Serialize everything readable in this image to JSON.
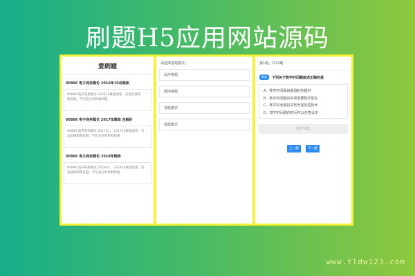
{
  "banner": {
    "title": "刷题H5应用网站源码"
  },
  "panel1": {
    "title": "爱刷题",
    "exams": [
      {
        "title": "00896 电子商务概论 2016年10月题库",
        "desc_lines": [
          "00896 电子商务概论 201610真题试卷，包含选择和",
          "简答题，不包含分析和材料题"
        ]
      },
      {
        "title": "00896 电子商务概论 2017年题库 含解析",
        "desc_lines": [
          "00896 电子商务概论 201704， 201710真题试卷，包",
          "含选择和简答题，不包含分析和材料题"
        ]
      },
      {
        "title": "00896 电子商务概论 2018年题库",
        "desc_lines": [
          "00896 电子商务概论 201804， 201810真题试卷，包",
          "含选择和简答题，不包含分析和材料题"
        ]
      }
    ]
  },
  "panel2": {
    "hint": "请选择答题模式：",
    "modes": [
      "乱序答题",
      "顺序答题",
      "背题模式",
      "错题模式"
    ]
  },
  "panel3": {
    "progress": "第1题，共30题",
    "badge": "单选",
    "question": "下列关于数字时间戳叙述正确的是",
    "options": [
      "A．数字时间戳由金融机构提供",
      "B．数字时间戳的实现需要数字签名",
      "C．数字时间戳的实现无需加密技术",
      "D．数字时间戳的时间可以任意设定"
    ],
    "confirm_label": "确定答案",
    "prev_label": "上一题",
    "next_label": "下一题"
  },
  "watermark": "www.tldw123.com"
}
